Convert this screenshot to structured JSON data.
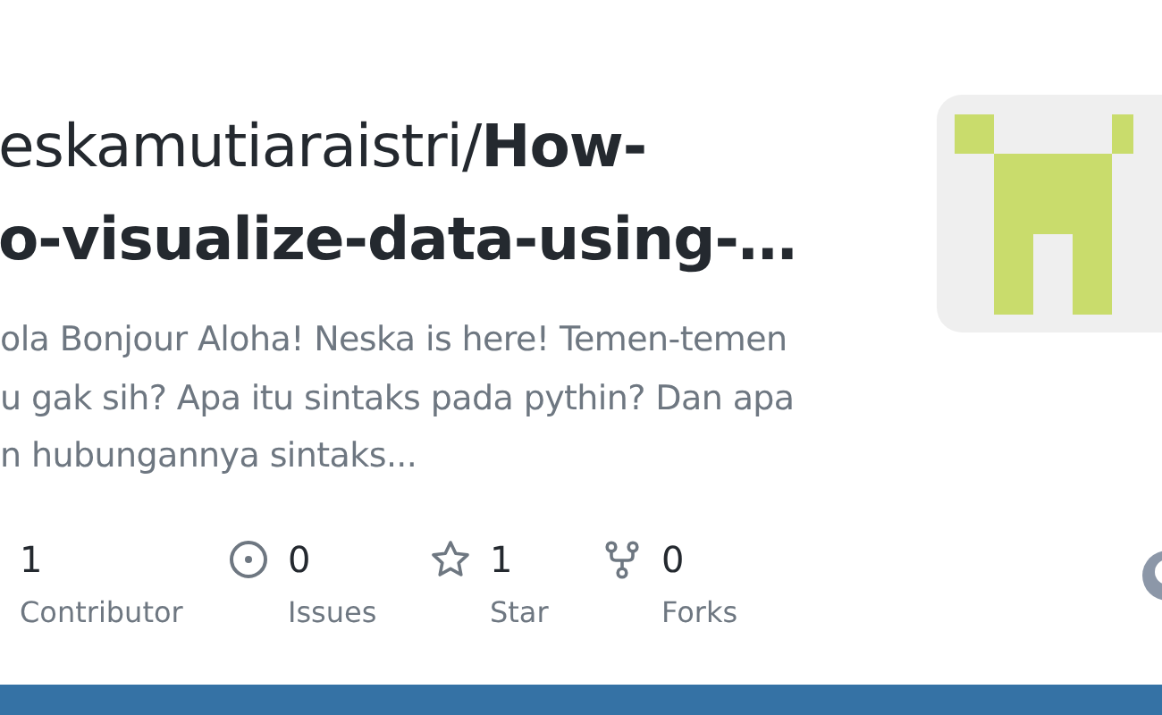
{
  "repo": {
    "title_lines": [
      "eskamutiaraistri/**How-**",
      "o-visualize-data-using-…"
    ],
    "description_lines": [
      "ola Bonjour Aloha! Neska is here! Temen-temen",
      "u gak sih? Apa itu sintaks pada pythin? Dan apa",
      "n hubungannya sintaks..."
    ]
  },
  "stats": [
    {
      "kind": "contributors",
      "count": "1",
      "label": "Contributor"
    },
    {
      "kind": "issues",
      "count": "0",
      "label": "Issues"
    },
    {
      "kind": "stars",
      "count": "1",
      "label": "Star"
    },
    {
      "kind": "forks",
      "count": "0",
      "label": "Forks"
    }
  ],
  "language_bar": {
    "color": "#3572a5"
  }
}
